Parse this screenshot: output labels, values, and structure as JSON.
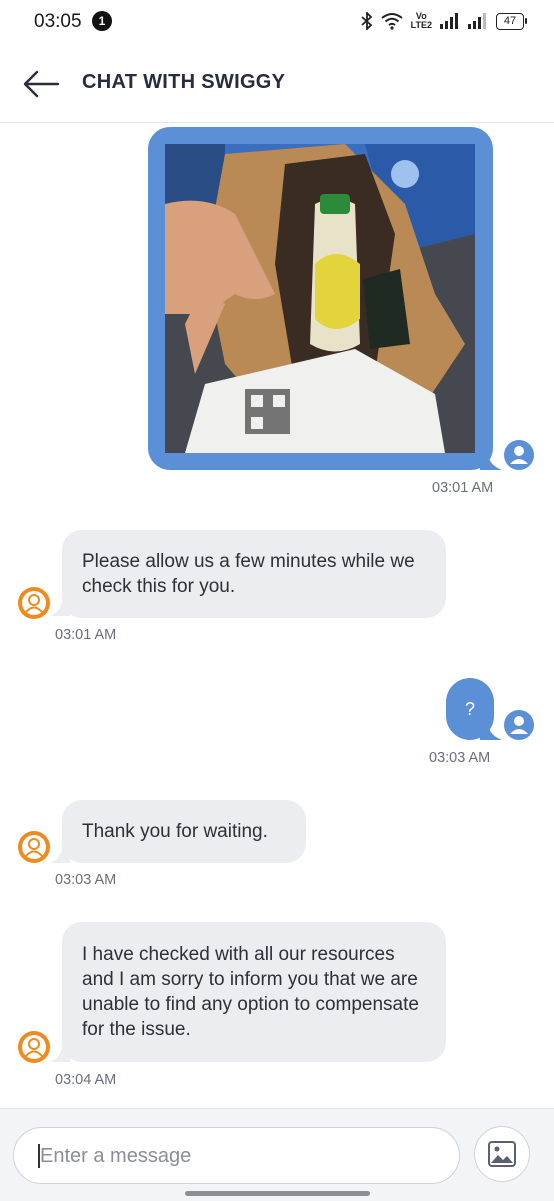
{
  "status_bar": {
    "time": "03:05",
    "notification_count": "1",
    "volte_top": "Vo",
    "volte_bottom": "LTE2",
    "battery": "47"
  },
  "header": {
    "title": "CHAT WITH SWIGGY",
    "back_icon": "arrow-left-icon"
  },
  "messages": [
    {
      "from": "user",
      "type": "image",
      "image_desc": "photo-of-paper-bag-with-drink-bottle",
      "time": "03:01 AM"
    },
    {
      "from": "bot",
      "text": "Please allow us a few minutes while we check this for you.",
      "time": "03:01 AM"
    },
    {
      "from": "user",
      "type": "text",
      "text": "?",
      "time": "03:03 AM"
    },
    {
      "from": "bot",
      "text": "Thank you for waiting.",
      "time": "03:03 AM"
    },
    {
      "from": "bot",
      "text": "I have checked with all our resources and I am sorry to inform you that we are unable to find any option to compensate for the issue.",
      "time": "03:04 AM"
    }
  ],
  "composer": {
    "placeholder": "Enter a message",
    "attach_icon": "image-icon"
  },
  "colors": {
    "user_bubble": "#5b8fd6",
    "bot_bubble": "#ebedf0",
    "bot_avatar": "#f08a1e"
  }
}
